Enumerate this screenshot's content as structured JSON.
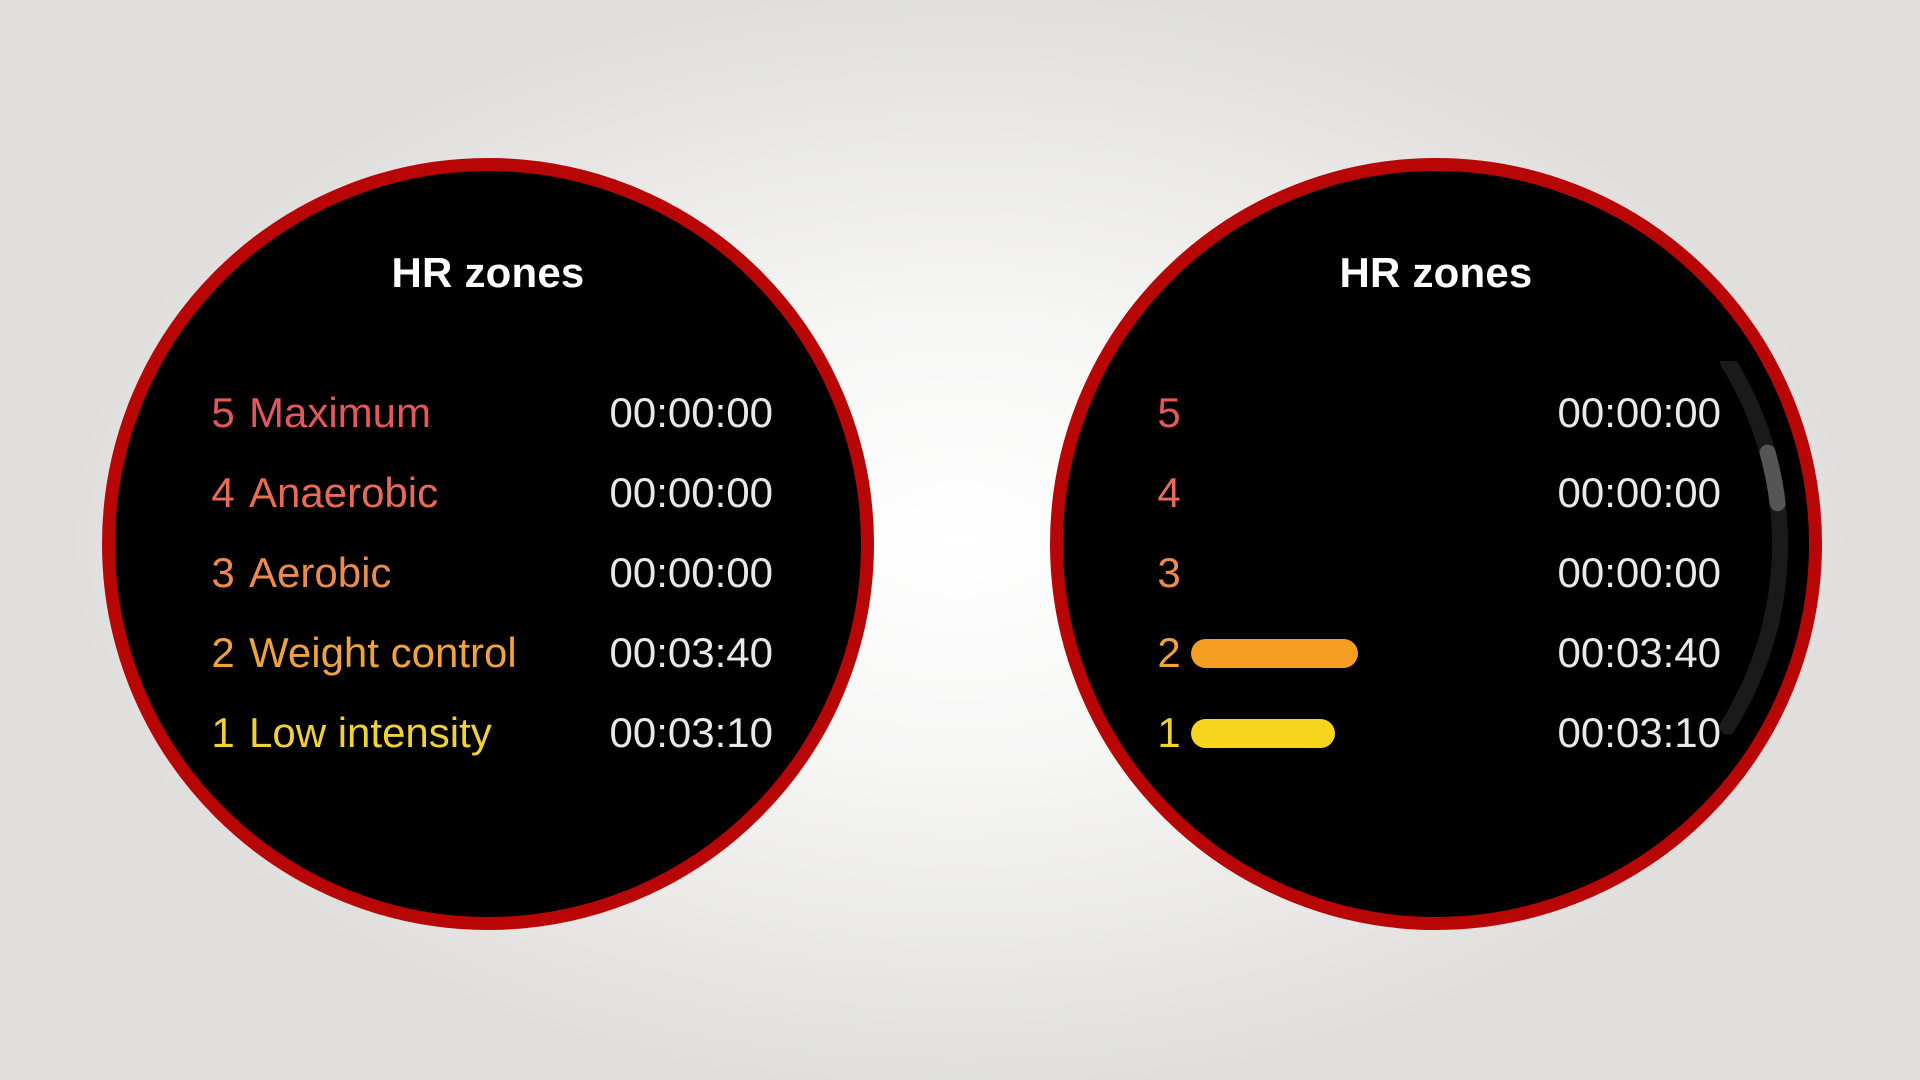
{
  "screens": [
    {
      "id": "left",
      "title": "HR zones",
      "mode": "labels",
      "zones": [
        {
          "number": "5",
          "label": "Maximum",
          "time": "00:00:00",
          "color": "#e4575a"
        },
        {
          "number": "4",
          "label": "Anaerobic",
          "time": "00:00:00",
          "color": "#ea6a55"
        },
        {
          "number": "3",
          "label": "Aerobic",
          "time": "00:00:00",
          "color": "#ee8a4e"
        },
        {
          "number": "2",
          "label": "Weight control",
          "time": "00:03:40",
          "color": "#f0a23c"
        },
        {
          "number": "1",
          "label": "Low intensity",
          "time": "00:03:10",
          "color": "#f2d232"
        }
      ]
    },
    {
      "id": "right",
      "title": "HR zones",
      "mode": "bars",
      "zones": [
        {
          "number": "5",
          "time": "00:00:00",
          "seconds": 0,
          "color": "#e4575a",
          "bar_color": "#e4575a"
        },
        {
          "number": "4",
          "time": "00:00:00",
          "seconds": 0,
          "color": "#ea6a55",
          "bar_color": "#ea6a55"
        },
        {
          "number": "3",
          "time": "00:00:00",
          "seconds": 0,
          "color": "#ee8a4e",
          "bar_color": "#ee8a4e"
        },
        {
          "number": "2",
          "time": "00:03:40",
          "seconds": 220,
          "color": "#f0a23c",
          "bar_color": "#f59e22"
        },
        {
          "number": "1",
          "time": "00:03:10",
          "seconds": 190,
          "color": "#f2d232",
          "bar_color": "#f7d51c"
        }
      ],
      "scroll_position": 0.3
    }
  ],
  "colors": {
    "ring": "#b80606",
    "watch_bg": "#000000",
    "time_text": "#e9e9e9",
    "scroll_track": "#1a1a1a",
    "scroll_thumb": "#555555"
  }
}
